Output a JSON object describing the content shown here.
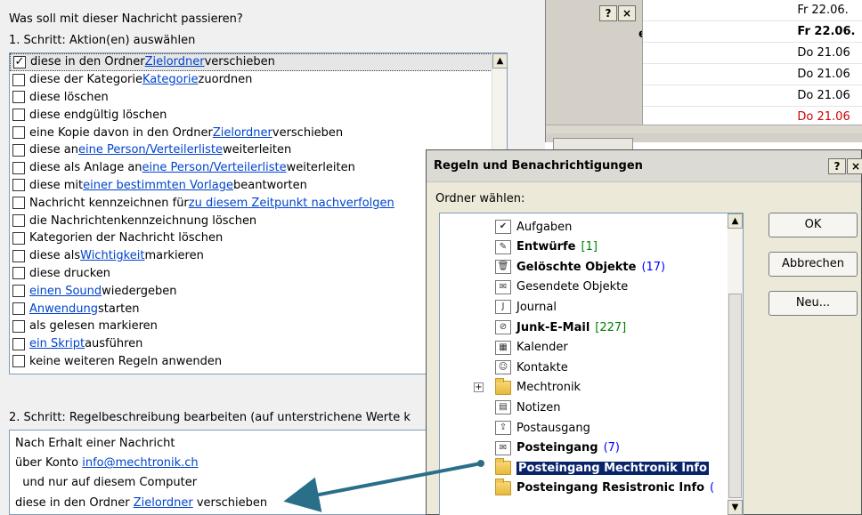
{
  "bg_window": {
    "help_label": "?",
    "close_label": "×",
    "partial_label": "en",
    "rows": [
      {
        "date": "Fr 22.06.",
        "bold": false,
        "red": false
      },
      {
        "date": "Fr 22.06.",
        "bold": true,
        "red": false
      },
      {
        "date": "Do 21.06",
        "bold": false,
        "red": false
      },
      {
        "date": "Do 21.06",
        "bold": false,
        "red": false
      },
      {
        "date": "Do 21.06",
        "bold": false,
        "red": false
      },
      {
        "date": "Do 21.06",
        "bold": false,
        "red": true
      }
    ]
  },
  "wizard": {
    "question": "Was soll mit dieser Nachricht passieren?",
    "step1": "1. Schritt: Aktion(en) auswählen",
    "step2": "2. Schritt: Regelbeschreibung bearbeiten (auf unterstrichene Werte k",
    "actions": [
      {
        "pre": "diese in den Ordner ",
        "link": "Zielordner",
        "post": " verschieben",
        "checked": true,
        "selected": true
      },
      {
        "pre": "diese der Kategorie ",
        "link": "Kategorie",
        "post": " zuordnen",
        "checked": false
      },
      {
        "pre": "diese löschen",
        "link": "",
        "post": "",
        "checked": false
      },
      {
        "pre": "diese endgültig löschen",
        "link": "",
        "post": "",
        "checked": false
      },
      {
        "pre": "eine Kopie davon in den Ordner ",
        "link": "Zielordner",
        "post": " verschieben",
        "checked": false
      },
      {
        "pre": "diese an ",
        "link": "eine Person/Verteilerliste",
        "post": " weiterleiten",
        "checked": false
      },
      {
        "pre": "diese als Anlage an ",
        "link": "eine Person/Verteilerliste",
        "post": " weiterleiten",
        "checked": false
      },
      {
        "pre": "diese mit ",
        "link": "einer bestimmten Vorlage",
        "post": " beantworten",
        "checked": false
      },
      {
        "pre": "Nachricht kennzeichnen für ",
        "link": "zu diesem Zeitpunkt nachverfolgen",
        "post": "",
        "checked": false
      },
      {
        "pre": "die Nachrichtenkennzeichnung löschen",
        "link": "",
        "post": "",
        "checked": false
      },
      {
        "pre": "Kategorien der Nachricht löschen",
        "link": "",
        "post": "",
        "checked": false
      },
      {
        "pre": "diese als ",
        "link": "Wichtigkeit",
        "post": " markieren",
        "checked": false
      },
      {
        "pre": "diese drucken",
        "link": "",
        "post": "",
        "checked": false
      },
      {
        "pre": "",
        "link": "einen Sound",
        "post": " wiedergeben",
        "checked": false
      },
      {
        "pre": "",
        "link": "Anwendung",
        "post": " starten",
        "checked": false
      },
      {
        "pre": "als gelesen markieren",
        "link": "",
        "post": "",
        "checked": false
      },
      {
        "pre": "",
        "link": "ein Skript",
        "post": " ausführen",
        "checked": false
      },
      {
        "pre": "keine weiteren Regeln anwenden",
        "link": "",
        "post": "",
        "checked": false
      }
    ],
    "description": [
      {
        "pre": "Nach Erhalt einer Nachricht",
        "link": "",
        "post": ""
      },
      {
        "pre": "über Konto ",
        "link": "info@mechtronik.ch",
        "post": ""
      },
      {
        "pre": "  und nur auf diesem Computer",
        "link": "",
        "post": ""
      },
      {
        "pre": "diese in den Ordner ",
        "link": "Zielordner",
        "post": " verschieben"
      }
    ]
  },
  "dialog": {
    "title": "Regeln und Benachrichtigungen",
    "help_label": "?",
    "close_label": "×",
    "folder_label": "Ordner wählen:",
    "ok_label": "OK",
    "cancel_label": "Abbrechen",
    "new_label": "Neu...",
    "folders": [
      {
        "name": "Aufgaben",
        "icon": "tasks-icon",
        "glyph": "✔",
        "bold": false,
        "count": "",
        "count_color": ""
      },
      {
        "name": "Entwürfe",
        "icon": "drafts-icon",
        "glyph": "✎",
        "bold": true,
        "count": "[1]",
        "count_color": "green"
      },
      {
        "name": "Gelöschte Objekte",
        "icon": "deleted-items-icon",
        "glyph": "🗑",
        "bold": true,
        "count": "(17)",
        "count_color": "blue"
      },
      {
        "name": "Gesendete Objekte",
        "icon": "sent-items-icon",
        "glyph": "✉",
        "bold": false,
        "count": "",
        "count_color": ""
      },
      {
        "name": "Journal",
        "icon": "journal-icon",
        "glyph": "J",
        "bold": false,
        "count": "",
        "count_color": ""
      },
      {
        "name": "Junk-E-Mail",
        "icon": "junk-mail-icon",
        "glyph": "⊘",
        "bold": true,
        "count": "[227]",
        "count_color": "green"
      },
      {
        "name": "Kalender",
        "icon": "calendar-icon",
        "glyph": "▦",
        "bold": false,
        "count": "",
        "count_color": ""
      },
      {
        "name": "Kontakte",
        "icon": "contacts-icon",
        "glyph": "☺",
        "bold": false,
        "count": "",
        "count_color": ""
      },
      {
        "name": "Mechtronik",
        "icon": "folder-icon",
        "glyph": "",
        "bold": false,
        "count": "",
        "count_color": "",
        "expander": "+"
      },
      {
        "name": "Notizen",
        "icon": "notes-icon",
        "glyph": "▤",
        "bold": false,
        "count": "",
        "count_color": ""
      },
      {
        "name": "Postausgang",
        "icon": "outbox-icon",
        "glyph": "⇪",
        "bold": false,
        "count": "",
        "count_color": ""
      },
      {
        "name": "Posteingang",
        "icon": "inbox-icon",
        "glyph": "✉",
        "bold": true,
        "count": "(7)",
        "count_color": "blue"
      },
      {
        "name": "Posteingang Mechtronik Info",
        "icon": "folder-icon",
        "glyph": "",
        "bold": true,
        "count": "",
        "count_color": "",
        "selected": true
      },
      {
        "name": "Posteingang Resistronic Info",
        "icon": "folder-icon",
        "glyph": "",
        "bold": true,
        "count": "(",
        "count_color": "blue"
      }
    ]
  },
  "colors": {
    "link": "#0044cc",
    "selection": "#0a246a",
    "annotation_arrow": "#2a6f8a"
  }
}
